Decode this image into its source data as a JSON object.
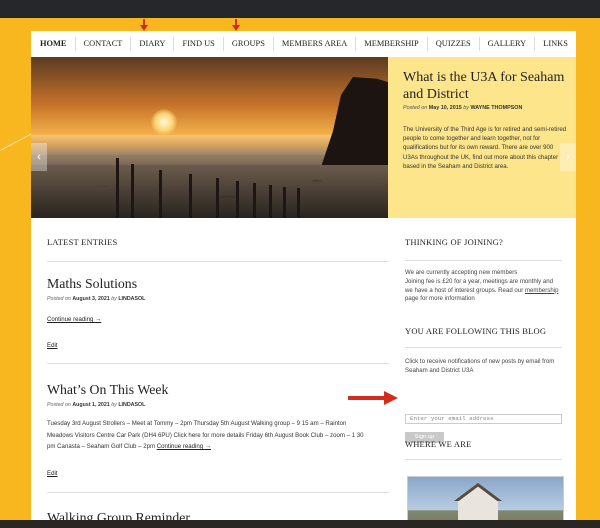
{
  "nav": {
    "items": [
      "HOME",
      "CONTACT",
      "DIARY",
      "FIND US",
      "GROUPS",
      "MEMBERS AREA",
      "MEMBERSHIP",
      "QUIZZES",
      "GALLERY",
      "LINKS"
    ]
  },
  "hero": {
    "title": "What is the U3A for Seaham and District",
    "posted_on_label": "Posted on",
    "date": "May 10, 2015",
    "by_label": "by",
    "author": "WAYNE THOMPSON",
    "description": "The University of the Third Age is for retired and semi-retired people to come together and learn together, not for qualifications but for its own reward. There are over 900 U3As throughout the UK, find out more about this chapter based in the Seaham and District area.",
    "prev_glyph": "‹",
    "next_glyph": "›"
  },
  "main": {
    "section_title": "LATEST ENTRIES",
    "posts": [
      {
        "title": "Maths Solutions",
        "posted_on_label": "Posted on",
        "date": "August 3, 2021",
        "by_label": "by",
        "author": "LINDASOL",
        "continue": "Continue reading →",
        "edit": "Edit"
      },
      {
        "title": "What’s On This Week",
        "posted_on_label": "Posted on",
        "date": "August 1, 2021",
        "by_label": "by",
        "author": "LINDASOL",
        "body": "Tuesday 3rd August Strollers – Meet at Tommy – 2pm Thursday 5th August Walking group – 9 15 am – Rainton Meadows Visitors Centre Car Park (DH4 6PU) Click here for more details Friday 6th August Book Club – zoom – 1 30 pm Canasta – Seaham Golf Club – 2pm",
        "continue": "Continue reading →",
        "edit": "Edit"
      },
      {
        "title": "Walking Group Reminder"
      }
    ]
  },
  "sidebar": {
    "joining_title": "THINKING OF JOINING?",
    "joining_text_1": "We are currently accepting new members",
    "joining_text_2": "Joining fee is £20 for a year, meetings are monthly and we have a host of interest groups. Read our",
    "joining_link": "membership",
    "joining_text_3": "page for more information",
    "follow_title": "YOU ARE FOLLOWING THIS BLOG",
    "follow_text": "Click to receive notifications of new posts by email from Seaham and District U3A",
    "email_placeholder": "Enter your email address",
    "signup_label": "Sign up",
    "where_title": "WHERE WE ARE"
  },
  "colors": {
    "background": "#f9b71f",
    "hero_panel": "#fde58b",
    "annotation_arrow": "#d42b1e"
  }
}
